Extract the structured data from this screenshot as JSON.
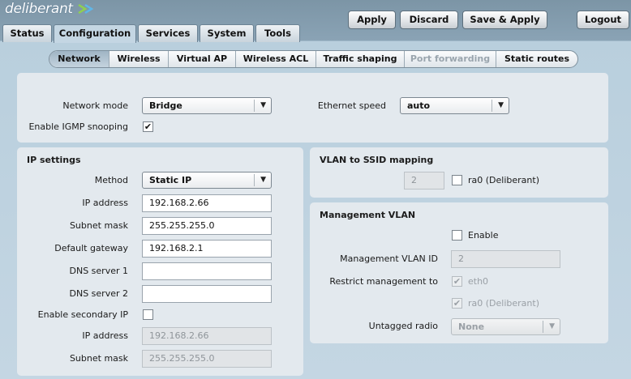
{
  "app": {
    "logo_text": "deliberant"
  },
  "actions": {
    "apply": "Apply",
    "discard": "Discard",
    "save_apply": "Save & Apply",
    "logout": "Logout"
  },
  "tabs": [
    {
      "label": "Status"
    },
    {
      "label": "Configuration",
      "active": true
    },
    {
      "label": "Services"
    },
    {
      "label": "System"
    },
    {
      "label": "Tools"
    }
  ],
  "subtabs": [
    {
      "label": "Network",
      "active": true
    },
    {
      "label": "Wireless"
    },
    {
      "label": "Virtual AP"
    },
    {
      "label": "Wireless ACL"
    },
    {
      "label": "Traffic shaping"
    },
    {
      "label": "Port forwarding",
      "disabled": true
    },
    {
      "label": "Static routes"
    }
  ],
  "general": {
    "network_mode_label": "Network mode",
    "network_mode_value": "Bridge",
    "ethernet_speed_label": "Ethernet speed",
    "ethernet_speed_value": "auto",
    "igmp_label": "Enable IGMP snooping",
    "igmp_checked": true
  },
  "ip_settings": {
    "title": "IP settings",
    "method_label": "Method",
    "method_value": "Static IP",
    "ip_label": "IP address",
    "ip_value": "192.168.2.66",
    "mask_label": "Subnet mask",
    "mask_value": "255.255.255.0",
    "gateway_label": "Default gateway",
    "gateway_value": "192.168.2.1",
    "dns1_label": "DNS server 1",
    "dns1_value": "",
    "dns2_label": "DNS server 2",
    "dns2_value": "",
    "secondary_label": "Enable secondary IP",
    "secondary_checked": false,
    "sec_ip_label": "IP address",
    "sec_ip_value": "192.168.2.66",
    "sec_mask_label": "Subnet mask",
    "sec_mask_value": "255.255.255.0"
  },
  "vlan_ssid": {
    "title": "VLAN to SSID mapping",
    "vlan_value": "2",
    "ssid_label": "ra0 (Deliberant)",
    "ssid_checked": false
  },
  "mgmt_vlan": {
    "title": "Management VLAN",
    "enable_label": "Enable",
    "enable_checked": false,
    "vlan_id_label": "Management VLAN ID",
    "vlan_id_value": "2",
    "restrict_label": "Restrict management to",
    "restrict_eth0": "eth0",
    "restrict_ra0": "ra0 (Deliberant)",
    "untagged_label": "Untagged radio",
    "untagged_value": "None"
  },
  "colors": {
    "header_bg": "#7c95a6",
    "page_bg": "#c4d6e3",
    "panel_bg": "#e3e9ee"
  }
}
